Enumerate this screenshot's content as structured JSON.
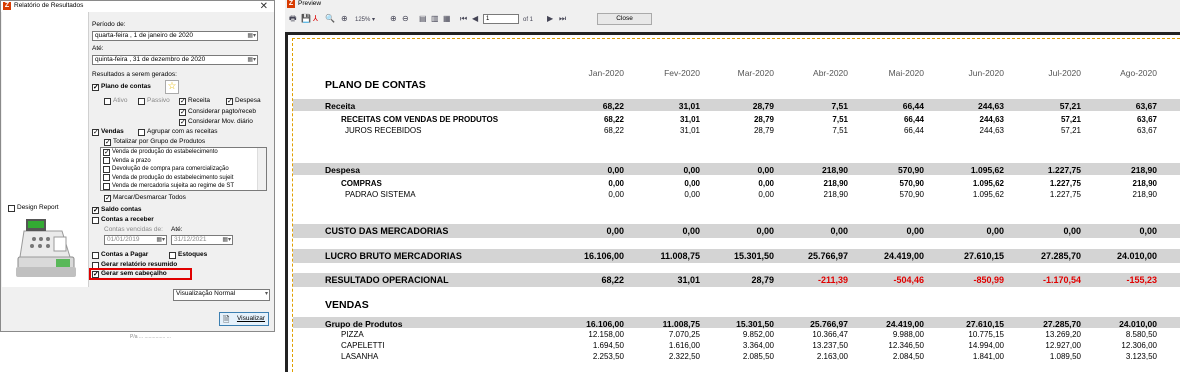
{
  "dialog": {
    "title": "Relatório de Resultados",
    "close": "✕",
    "periodo_label": "Período de:",
    "date_from": "quarta-feira ,  1 de  janeiro   de 2020",
    "ate_label": "Até:",
    "date_to": "quinta-feira , 31 de dezembro de 2020",
    "resultados_label": "Resultados a serem gerados:",
    "plano": "Plano de contas",
    "ativo": "Ativo",
    "passivo": "Passivo",
    "receita": "Receita",
    "despesa": "Despesa",
    "pagto": "Considerar pagto/receb",
    "mov": "Considerar Mov. diário",
    "vendas": "Vendas",
    "agrupar": "Agrupar com as receitas",
    "totalizar": "Totalizar por Grupo de Produtos",
    "list": [
      "Venda de produção do estabelecimento",
      "Venda a prazo",
      "Devolução de compra para comercialização",
      "Venda de produção do estabelecimento sujeit",
      "Venda de mercadoria sujeita ao regime de ST"
    ],
    "marcar": "Marcar/Desmarcar Todos",
    "saldo": "Saldo contas",
    "contas_receber": "Contas a receber",
    "contas_vencidas": "Contas vencidas de:",
    "ate2": "Até:",
    "d1": "01/01/2019",
    "d2": "31/12/2021",
    "contas_pagar": "Contas a Pagar",
    "estoques": "Estoques",
    "resumido": "Gerar relatório resumido",
    "sem_cab": "Gerar sem cabeçalho",
    "design": "Design Report",
    "visualizacao": "Visualização Normal",
    "visualizar": "Visualizar",
    "bottom_text": "P/a     ...   ...............    ..."
  },
  "preview": {
    "title": "Preview",
    "zoom": "125%",
    "page_num": "1",
    "of": "of 1",
    "close": "Close"
  },
  "report": {
    "months": [
      "Jan-2020",
      "Fev-2020",
      "Mar-2020",
      "Abr-2020",
      "Mai-2020",
      "Jun-2020",
      "Jul-2020",
      "Ago-2020"
    ],
    "plano_title": "PLANO DE CONTAS",
    "receita": {
      "label": "Receita",
      "vals": [
        "68,22",
        "31,01",
        "28,79",
        "7,51",
        "66,44",
        "244,63",
        "57,21",
        "63,67"
      ]
    },
    "rcv": {
      "label": "RECEITAS COM VENDAS DE PRODUTOS",
      "vals": [
        "68,22",
        "31,01",
        "28,79",
        "7,51",
        "66,44",
        "244,63",
        "57,21",
        "63,67"
      ]
    },
    "juros": {
      "label": "JUROS RECEBIDOS",
      "vals": [
        "68,22",
        "31,01",
        "28,79",
        "7,51",
        "66,44",
        "244,63",
        "57,21",
        "63,67"
      ]
    },
    "despesa": {
      "label": "Despesa",
      "vals": [
        "0,00",
        "0,00",
        "0,00",
        "218,90",
        "570,90",
        "1.095,62",
        "1.227,75",
        "218,90"
      ]
    },
    "compras": {
      "label": "COMPRAS",
      "vals": [
        "0,00",
        "0,00",
        "0,00",
        "218,90",
        "570,90",
        "1.095,62",
        "1.227,75",
        "218,90"
      ]
    },
    "padrao": {
      "label": "PADRAO SISTEMA",
      "vals": [
        "0,00",
        "0,00",
        "0,00",
        "218,90",
        "570,90",
        "1.095,62",
        "1.227,75",
        "218,90"
      ]
    },
    "custo": {
      "label": "CUSTO DAS MERCADORIAS",
      "vals": [
        "0,00",
        "0,00",
        "0,00",
        "0,00",
        "0,00",
        "0,00",
        "0,00",
        "0,00"
      ]
    },
    "lucro": {
      "label": "LUCRO BRUTO MERCADORIAS",
      "vals": [
        "16.106,00",
        "11.008,75",
        "15.301,50",
        "25.766,97",
        "24.419,00",
        "27.610,15",
        "27.285,70",
        "24.010,00"
      ]
    },
    "resultado": {
      "label": "RESULTADO OPERACIONAL",
      "vals": [
        "68,22",
        "31,01",
        "28,79",
        "-211,39",
        "-504,46",
        "-850,99",
        "-1.170,54",
        "-155,23"
      ]
    },
    "vendas_title": "VENDAS",
    "grupo": {
      "label": "Grupo de Produtos",
      "vals": [
        "16.106,00",
        "11.008,75",
        "15.301,50",
        "25.766,97",
        "24.419,00",
        "27.610,15",
        "27.285,70",
        "24.010,00"
      ]
    },
    "pizza": {
      "label": "PIZZA",
      "vals": [
        "12.158,00",
        "7.070,25",
        "9.852,00",
        "10.366,47",
        "9.988,00",
        "10.775,15",
        "13.269,20",
        "8.580,50"
      ]
    },
    "capeletti": {
      "label": "CAPELETTI",
      "vals": [
        "1.694,50",
        "1.616,00",
        "3.364,00",
        "13.237,50",
        "12.346,50",
        "14.994,00",
        "12.927,00",
        "12.306,00"
      ]
    },
    "lasanha": {
      "label": "LASANHA",
      "vals": [
        "2.253,50",
        "2.322,50",
        "2.085,50",
        "2.163,00",
        "2.084,50",
        "1.841,00",
        "1.089,50",
        "3.123,50"
      ]
    }
  }
}
